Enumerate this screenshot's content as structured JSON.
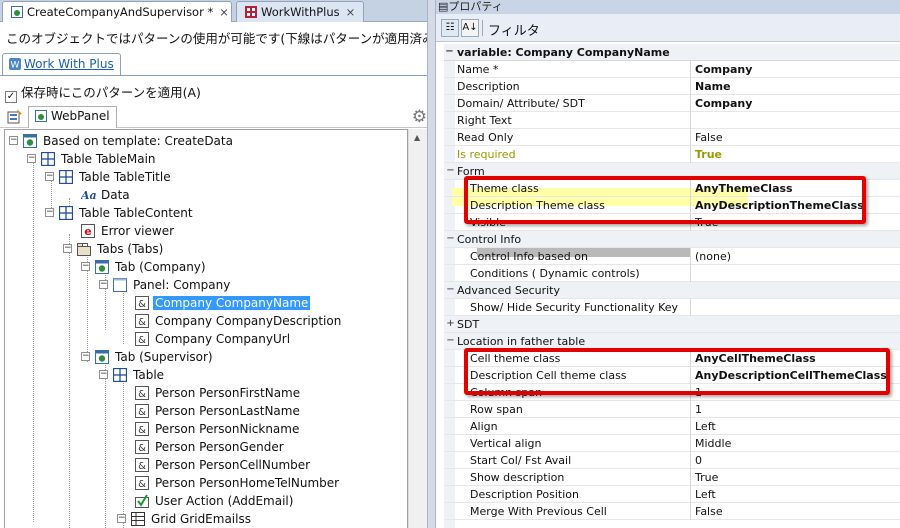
{
  "tabs": [
    {
      "label": "CreateCompanyAndSupervisor *",
      "closable": true
    },
    {
      "label": "WorkWithPlus",
      "closable": true
    }
  ],
  "info_text": "このオブジェクトではパターンの使用が可能です(下線はパターンが適用済み",
  "pattern_tab": "Work With Plus",
  "apply_checkbox": {
    "label": "保存時にこのパターンを適用(A)",
    "checked": true
  },
  "toolbar": {
    "webpanel_tab": "WebPanel"
  },
  "tree": [
    {
      "label": "Based on template: CreateData"
    },
    {
      "label": "Table TableMain"
    },
    {
      "label": "Table TableTitle"
    },
    {
      "label": "Data"
    },
    {
      "label": "Table TableContent"
    },
    {
      "label": "Error viewer"
    },
    {
      "label": "Tabs (Tabs)"
    },
    {
      "label": "Tab (Company)"
    },
    {
      "label": "Panel: Company"
    },
    {
      "label": "Company CompanyName"
    },
    {
      "label": "Company CompanyDescription"
    },
    {
      "label": "Company CompanyUrl"
    },
    {
      "label": "Tab (Supervisor)"
    },
    {
      "label": "Table"
    },
    {
      "label": "Person PersonFirstName"
    },
    {
      "label": "Person PersonLastName"
    },
    {
      "label": "Person PersonNickname"
    },
    {
      "label": "Person PersonGender"
    },
    {
      "label": "Person PersonCellNumber"
    },
    {
      "label": "Person PersonHomeTelNumber"
    },
    {
      "label": "User Action (AddEmail)"
    },
    {
      "label": "Grid GridEmailss"
    }
  ],
  "props": {
    "title": "プロパティ",
    "filter_label": "フィルタ",
    "header": "variable: Company CompanyName",
    "rows": [
      {
        "name": "Name *",
        "value": "Company"
      },
      {
        "name": "Description",
        "value": "Name"
      },
      {
        "name": "Domain/ Attribute/ SDT",
        "value": "Company"
      },
      {
        "name": "Right Text",
        "value": ""
      },
      {
        "name": "Read Only",
        "value": "False"
      },
      {
        "name": "Is required",
        "value": "True"
      },
      {
        "name": "Form",
        "value": ""
      },
      {
        "name": "Theme class",
        "value": "AnyThemeClass"
      },
      {
        "name": "Description Theme class",
        "value": "AnyDescriptionThemeClass"
      },
      {
        "name": "Visible",
        "value": "True"
      },
      {
        "name": "Control Info",
        "value": ""
      },
      {
        "name": "Control Info based on",
        "value": "(none)"
      },
      {
        "name": "Conditions ( Dynamic controls)",
        "value": ""
      },
      {
        "name": "Advanced Security",
        "value": ""
      },
      {
        "name": "Show/ Hide Security Functionality Key",
        "value": ""
      },
      {
        "name": "SDT",
        "value": ""
      },
      {
        "name": "Location in father table",
        "value": ""
      },
      {
        "name": "Cell theme class",
        "value": "AnyCellThemeClass"
      },
      {
        "name": "Description Cell theme class",
        "value": "AnyDescriptionCellThemeClass"
      },
      {
        "name": "Column span",
        "value": "1"
      },
      {
        "name": "Row span",
        "value": "1"
      },
      {
        "name": "Align",
        "value": "Left"
      },
      {
        "name": "Vertical align",
        "value": "Middle"
      },
      {
        "name": "Start Col/ Fst Avail",
        "value": "0"
      },
      {
        "name": "Show description",
        "value": "True"
      },
      {
        "name": "Description Position",
        "value": "Left"
      },
      {
        "name": "Merge With Previous Cell",
        "value": "False"
      }
    ]
  },
  "colors": {
    "highlight": "#ffffa8",
    "annotation": "#e20000",
    "selection": "#3399ff",
    "required_text": "#9a9a00"
  }
}
